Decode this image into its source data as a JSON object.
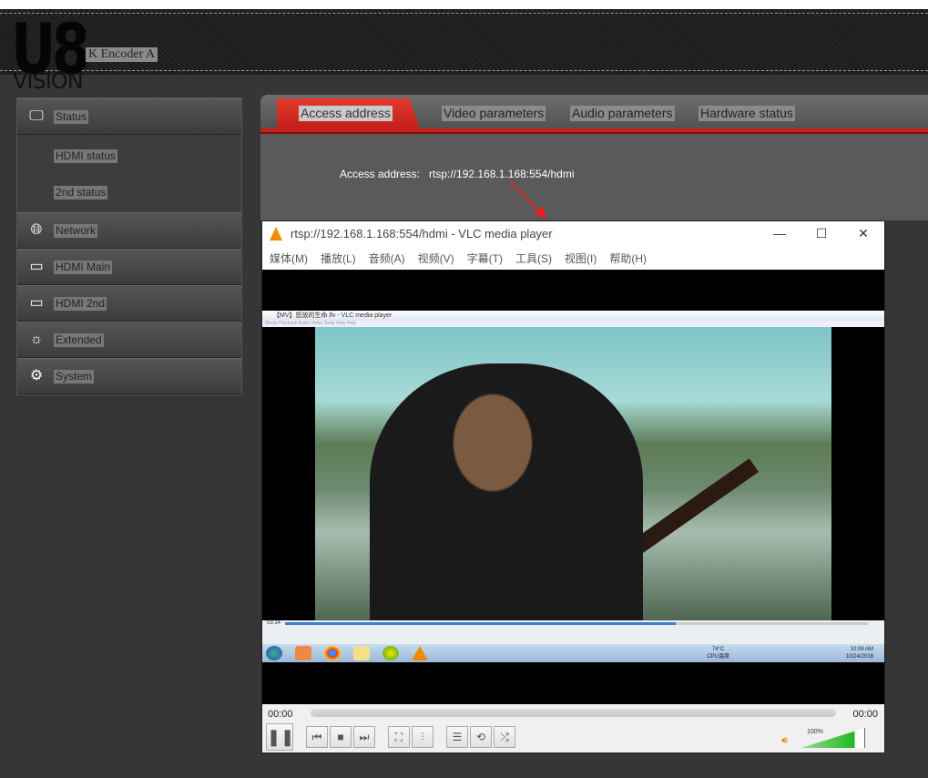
{
  "header": {
    "logo": "U8",
    "logo_sub": "VISION",
    "device_name": "K Encoder  A"
  },
  "sidebar": {
    "items": [
      {
        "label": "Status",
        "icon": "monitor-icon"
      },
      {
        "label": "Network",
        "icon": "globe-icon"
      },
      {
        "label": "HDMI Main",
        "icon": "hdmi-icon"
      },
      {
        "label": "HDMI 2nd",
        "icon": "hdmi-icon"
      },
      {
        "label": "Extended",
        "icon": "sun-gear-icon"
      },
      {
        "label": "System",
        "icon": "gear-icon"
      }
    ],
    "subitems": [
      "HDMI status",
      "2nd status"
    ]
  },
  "tabs": [
    "Access address",
    "Video parameters",
    "Audio parameters",
    "Hardware status"
  ],
  "content": {
    "label": "Access address:",
    "value": "rtsp://192.168.1.168:554/hdmi"
  },
  "vlc": {
    "title": "rtsp://192.168.1.168:554/hdmi - VLC media player",
    "menu": [
      "媒体(M)",
      "播放(L)",
      "音频(A)",
      "视频(V)",
      "字幕(T)",
      "工具(S)",
      "视图(I)",
      "帮助(H)"
    ],
    "time_elapsed": "00:00",
    "time_total": "00:00",
    "volume": "100%",
    "inner": {
      "title": "【MV】怒放的生命.flv - VLC media player",
      "menu": "Media  Playback  Audio  Video  Tools  View  Help",
      "time": "03:14",
      "progress": 0.67,
      "cpu_temp": "74°C",
      "cpu_label": "CPU温度",
      "clock_time": "10:08 AM",
      "clock_date": "10/24/2018"
    }
  },
  "colors": {
    "accent": "#c8201c",
    "vlc_orange": "#f28a00",
    "volume_green": "#1fb81f"
  }
}
